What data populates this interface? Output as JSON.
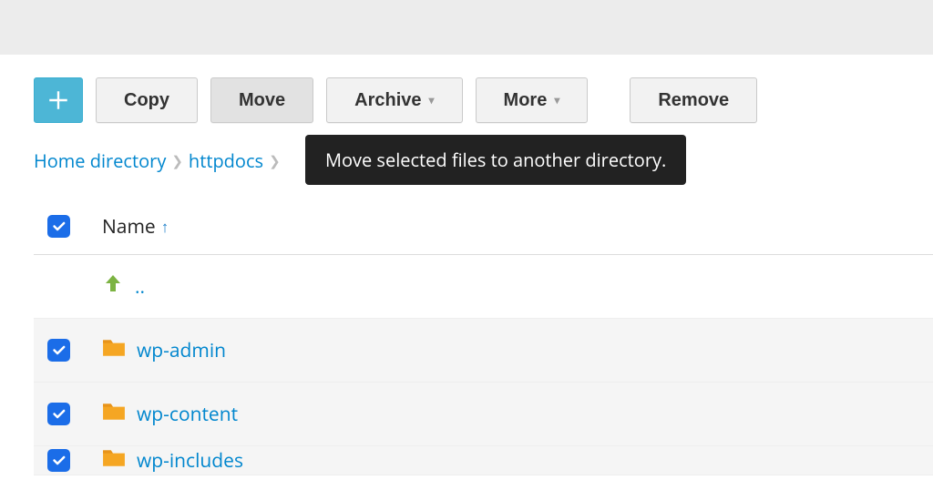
{
  "toolbar": {
    "copy_label": "Copy",
    "move_label": "Move",
    "archive_label": "Archive",
    "more_label": "More",
    "remove_label": "Remove"
  },
  "tooltip": "Move selected files to another directory.",
  "breadcrumb": {
    "home": "Home directory",
    "segment1": "httpdocs"
  },
  "table": {
    "header_name": "Name",
    "sort_indicator": "↑"
  },
  "rows": {
    "parent": "..",
    "r1": "wp-admin",
    "r2": "wp-content",
    "r3": "wp-includes"
  }
}
